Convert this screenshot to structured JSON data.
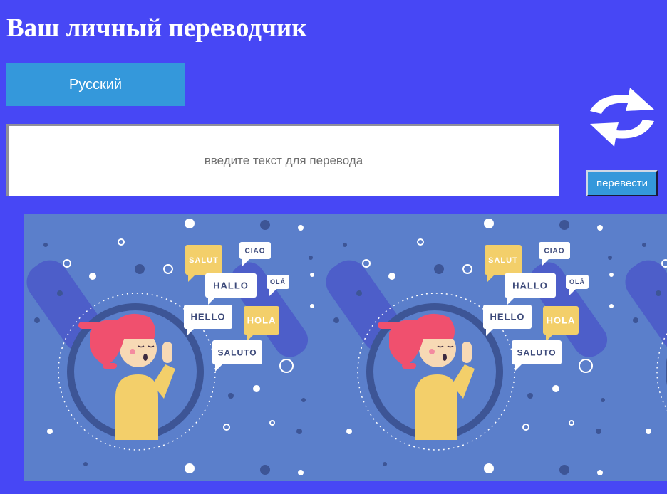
{
  "app": {
    "title": "Ваш личный переводчик"
  },
  "language_selector": {
    "label": "Русский"
  },
  "input": {
    "placeholder": "введите текст для перевода",
    "value": ""
  },
  "swap": {
    "icon": "swap-arrows-icon"
  },
  "translate_button": {
    "label": "перевести"
  },
  "banner": {
    "greetings": [
      "SALUT",
      "CIAO",
      "HALLO",
      "OLÁ",
      "HELLO",
      "HOLA",
      "SALUTO"
    ]
  },
  "colors": {
    "background": "#4747f5",
    "button": "#3498db",
    "banner_bg": "#5b7fcb",
    "bubble_white": "#ffffff",
    "bubble_yellow": "#f3cf6a",
    "hair": "#f0506e"
  }
}
